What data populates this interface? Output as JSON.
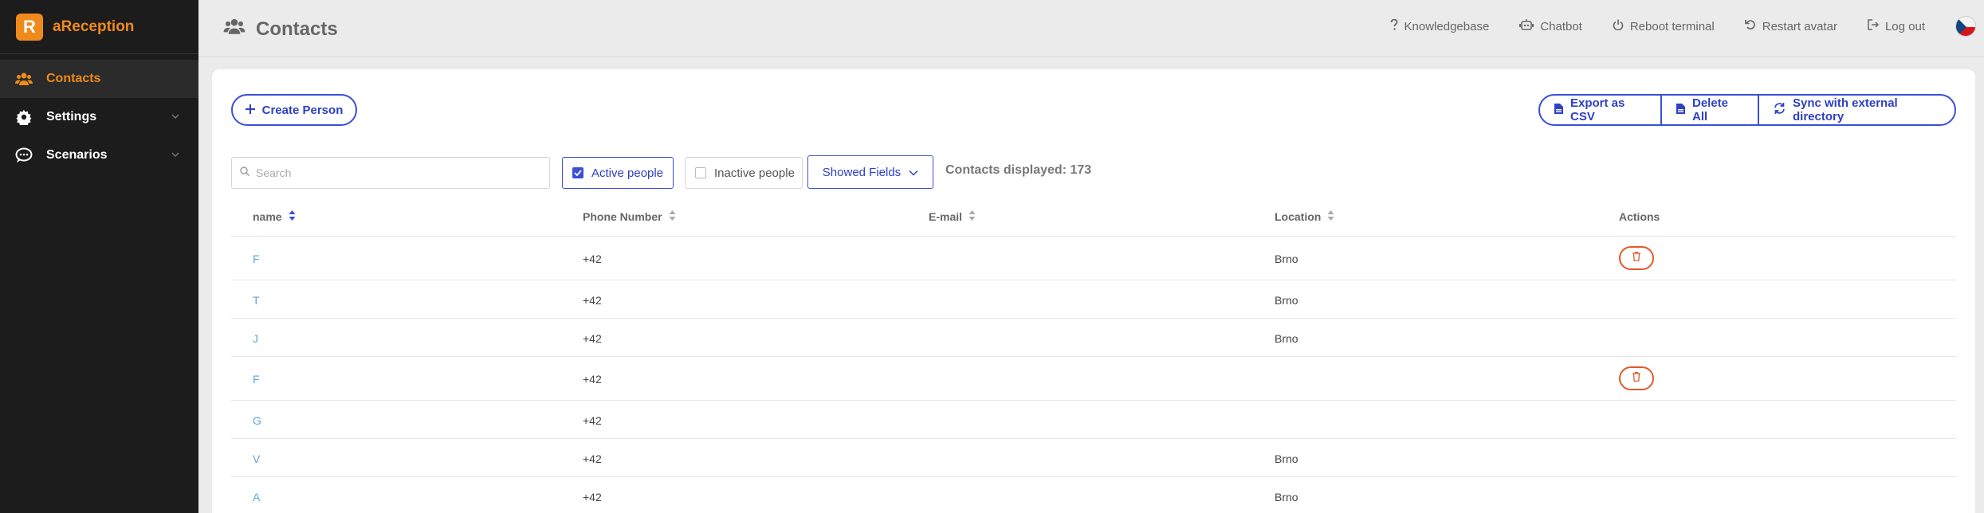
{
  "brand": {
    "logo_letter": "R",
    "name": "aReception",
    "accent": "#f08a1c"
  },
  "sidebar": {
    "items": [
      {
        "label": "Contacts",
        "icon": "users-icon",
        "active": true
      },
      {
        "label": "Settings",
        "icon": "gear-icon",
        "expandable": true
      },
      {
        "label": "Scenarios",
        "icon": "chat-icon",
        "expandable": true
      }
    ]
  },
  "header": {
    "title": "Contacts",
    "links": [
      {
        "label": "Knowledgebase",
        "icon": "question-icon"
      },
      {
        "label": "Chatbot",
        "icon": "robot-icon"
      },
      {
        "label": "Reboot terminal",
        "icon": "power-icon"
      },
      {
        "label": "Restart avatar",
        "icon": "restart-icon"
      },
      {
        "label": "Log out",
        "icon": "logout-icon"
      }
    ],
    "language_flag": "czech-flag-icon"
  },
  "toolbar": {
    "create_label": "Create Person",
    "export_label": "Export as CSV",
    "delete_all_label": "Delete All",
    "sync_label": "Sync with external directory"
  },
  "filters": {
    "search_placeholder": "Search",
    "active_label": "Active people",
    "active_checked": true,
    "inactive_label": "Inactive people",
    "inactive_checked": false,
    "showed_fields_label": "Showed Fields",
    "count_label": "Contacts displayed: 173"
  },
  "table": {
    "columns": [
      "name",
      "Phone Number",
      "E-mail",
      "Location",
      "Actions"
    ],
    "rows": [
      {
        "name": "F",
        "phone": "+42",
        "location": "Brno",
        "delete": true
      },
      {
        "name": "T",
        "phone": "+42",
        "location": "Brno",
        "delete": false
      },
      {
        "name": "J",
        "phone": "+42",
        "location": "Brno",
        "delete": false
      },
      {
        "name": "F",
        "phone": "+42",
        "location": "",
        "delete": true
      },
      {
        "name": "G",
        "phone": "+42",
        "location": "",
        "delete": false
      },
      {
        "name": "V",
        "phone": "+42",
        "location": "Brno",
        "delete": false
      },
      {
        "name": "A",
        "phone": "+42",
        "location": "Brno",
        "delete": false
      }
    ]
  },
  "colors": {
    "primary": "#3a4fd6",
    "danger": "#e05a2a",
    "link": "#5aa7d6"
  }
}
